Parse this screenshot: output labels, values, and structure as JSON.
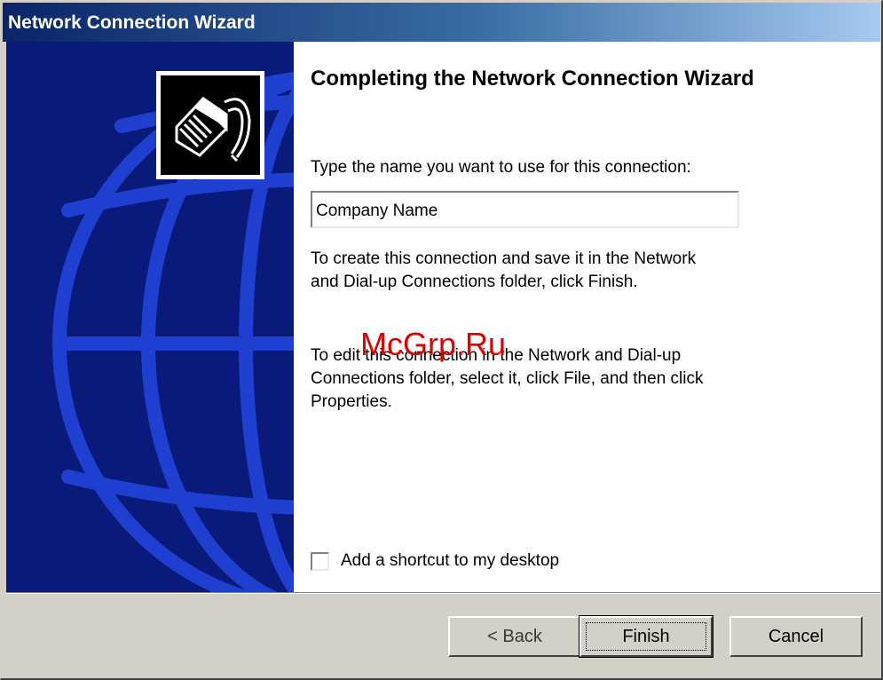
{
  "window": {
    "title": "Network Connection Wizard"
  },
  "wizard": {
    "icon": "network-cable-icon",
    "heading": "Completing the Network Connection Wizard",
    "name_prompt": "Type the name you want to use for this connection:",
    "connection_name": "Company Name",
    "instructions_finish": "To create this connection and save it in the Network and Dial-up Connections folder, click Finish.",
    "instructions_edit": "To edit this connection in the Network and Dial-up Connections folder, select it, click File, and then click Properties.",
    "shortcut_label": "Add a shortcut to my desktop",
    "shortcut_checked": false
  },
  "watermark": "McGrp.Ru",
  "buttons": {
    "back": "< Back",
    "finish": "Finish",
    "cancel": "Cancel"
  },
  "colors": {
    "title_gradient_start": "#0a246a",
    "title_gradient_end": "#a6caf0",
    "left_panel": "#0a1a7a",
    "globe_lines": "#1f3fd0",
    "dialog_face": "#d4d0c8",
    "watermark": "#e00000"
  }
}
